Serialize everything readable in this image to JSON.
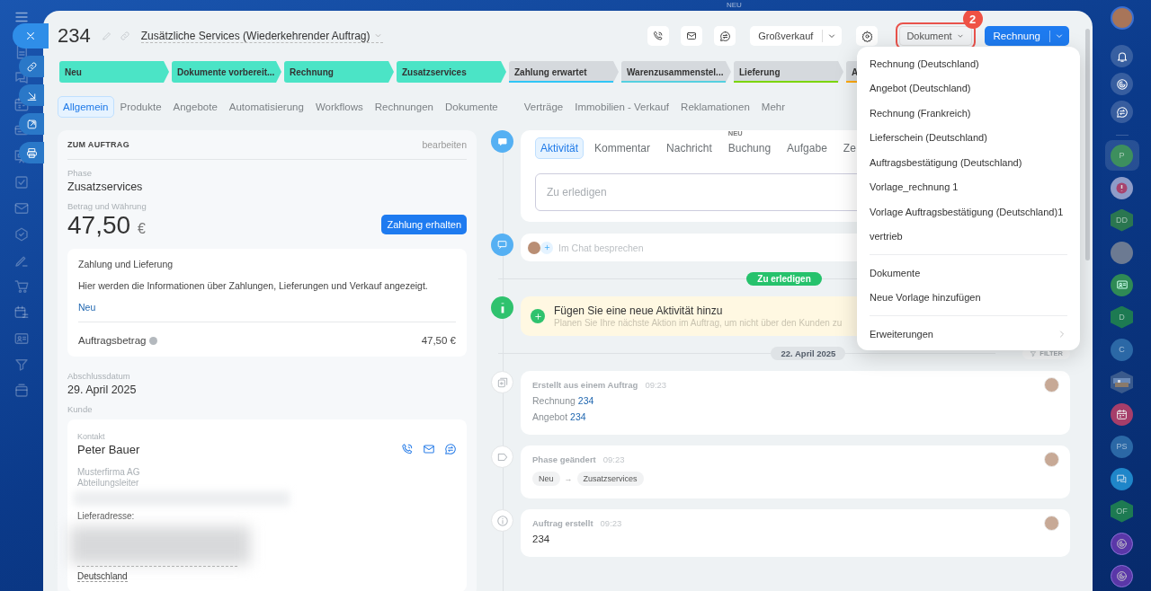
{
  "background_badge": "NEU",
  "header": {
    "number": "234",
    "category": "Zusätzliche Services (Wiederkehrender Auftrag)",
    "funnel": "Großverkauf",
    "document_button": "Dokument",
    "step_badge": "2",
    "primary_button": "Rechnung"
  },
  "stages": [
    {
      "label": "Neu",
      "reached": true,
      "color": "#4be4c6"
    },
    {
      "label": "Dokumente vorbereit...",
      "reached": true,
      "color": "#4be4c6"
    },
    {
      "label": "Rechnung",
      "reached": true,
      "color": "#4be4c6"
    },
    {
      "label": "Zusatzservices",
      "reached": true,
      "color": "#4be4c6"
    },
    {
      "label": "Zahlung erwartet",
      "reached": false,
      "color": "#2fc6f6"
    },
    {
      "label": "Warenzusammenstel...",
      "reached": false,
      "color": "#55d0e0"
    },
    {
      "label": "Lieferung",
      "reached": false,
      "color": "#7bd500"
    },
    {
      "label": "A",
      "reached": false,
      "color": "#ffa900"
    }
  ],
  "tabs": [
    {
      "label": "Allgemein",
      "selected": true
    },
    {
      "label": "Produkte",
      "selected": false
    },
    {
      "label": "Angebote",
      "selected": false
    },
    {
      "label": "Automatisierung",
      "selected": false
    },
    {
      "label": "Workflows",
      "selected": false
    },
    {
      "label": "Rechnungen",
      "selected": false
    },
    {
      "label": "Dokumente",
      "selected": false
    },
    {
      "label": "Verträge",
      "selected": false
    },
    {
      "label": "Immobilien - Verkauf",
      "selected": false
    },
    {
      "label": "Reklamationen",
      "selected": false
    },
    {
      "label": "Mehr",
      "selected": false
    }
  ],
  "order_card": {
    "title": "ZUM AUFTRAG",
    "edit": "bearbeiten",
    "phase_label": "Phase",
    "phase": "Zusatzservices",
    "amount_label": "Betrag und Währung",
    "amount": "47,50",
    "currency": "€",
    "pay_button": "Zahlung erhalten",
    "payment": {
      "title": "Zahlung und Lieferung",
      "text": "Hier werden die Informationen über Zahlungen, Lieferungen und Verkauf angezeigt.",
      "new_link": "Neu",
      "total_label": "Auftragsbetrag",
      "total": "47,50 €"
    },
    "close_label": "Abschlussdatum",
    "close_date": "29. April 2025",
    "client_label": "Kunde",
    "contact": {
      "label": "Kontakt",
      "name": "Peter Bauer",
      "company": "Musterfirma AG",
      "position": "Abteilungsleiter",
      "address_label": "Lieferadresse:",
      "country": "Deutschland"
    }
  },
  "activity": {
    "tabs": [
      {
        "label": "Aktivität",
        "selected": true
      },
      {
        "label": "Kommentar",
        "selected": false
      },
      {
        "label": "Nachricht",
        "selected": false
      },
      {
        "label": "Buchung",
        "selected": false,
        "badge": "NEU"
      },
      {
        "label": "Aufgabe",
        "selected": false
      },
      {
        "label": "Ze",
        "selected": false
      }
    ],
    "placeholder": "Zu erledigen",
    "chat_placeholder": "Im Chat besprechen",
    "todo_pill": "Zu erledigen",
    "hint_title": "Fügen Sie eine neue Aktivität hinzu",
    "hint_text": "Planen Sie Ihre nächste Aktion im Auftrag, um nicht über den Kunden zu",
    "date": "22. April 2025",
    "filter": "FILTER"
  },
  "timeline": [
    {
      "kind": "created_from",
      "title": "Erstellt aus einem Auftrag",
      "time": "09:23",
      "links": [
        {
          "label": "Rechnung",
          "number": "234"
        },
        {
          "label": "Angebot",
          "number": "234"
        }
      ]
    },
    {
      "kind": "phase",
      "title": "Phase geändert",
      "time": "09:23",
      "from": "Neu",
      "arrow": "→",
      "to": "Zusatzservices"
    },
    {
      "kind": "created",
      "title": "Auftrag erstellt",
      "time": "09:23",
      "text": "234"
    }
  ],
  "document_menu": {
    "templates": [
      "Rechnung (Deutschland)",
      "Angebot (Deutschland)",
      "Rechnung (Frankreich)",
      "Lieferschein (Deutschland)",
      "Auftragsbestätigung (Deutschland)",
      "Vorlage_rechnung 1",
      "Vorlage Auftragsbestätigung (Deutschland)1",
      "vertrieb"
    ],
    "actions": [
      "Dokumente",
      "Neue Vorlage hinzufügen"
    ],
    "extensions": "Erweiterungen"
  },
  "right_bar": [
    {
      "kind": "letter",
      "text": "P",
      "color": "#3d8f5e",
      "selected": true
    },
    {
      "kind": "alert",
      "selected": false
    },
    {
      "kind": "hex",
      "text": "DD",
      "color": "#2a7650",
      "selected": false
    },
    {
      "kind": "avatar",
      "selected": false
    },
    {
      "kind": "card",
      "selected": false
    },
    {
      "kind": "hex",
      "text": "D",
      "color": "#1d7a52",
      "selected": false
    },
    {
      "kind": "letter",
      "text": "C",
      "color": "#2b68a6",
      "selected": false
    },
    {
      "kind": "picture",
      "selected": false
    },
    {
      "kind": "calendar",
      "selected": false
    },
    {
      "kind": "letter",
      "text": "PS",
      "color": "#2b68a6",
      "selected": false
    },
    {
      "kind": "chat",
      "selected": false
    },
    {
      "kind": "hex",
      "text": "OF",
      "color": "#1d7a52",
      "selected": false
    },
    {
      "kind": "spiral",
      "selected": false
    },
    {
      "kind": "spiral",
      "selected": false
    }
  ]
}
